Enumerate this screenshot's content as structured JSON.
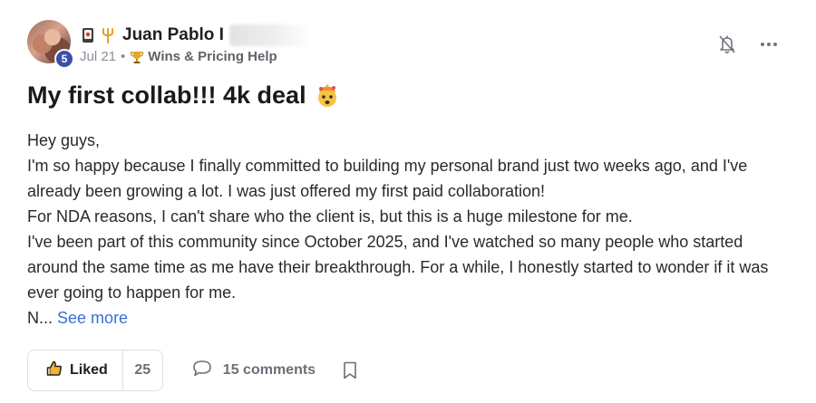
{
  "author": {
    "name": "Juan Pablo I",
    "level": "5",
    "icons": [
      "mobile-phone-icon",
      "trident-icon"
    ],
    "name_redacted": true
  },
  "meta": {
    "date": "Jul 21",
    "separator": "•",
    "category_icon": "trophy-icon",
    "category": "Wins & Pricing Help"
  },
  "header_actions": {
    "notify_icon": "bell-off-icon",
    "more_icon": "more-horizontal-icon"
  },
  "post": {
    "title": "My first collab!!! 4k deal",
    "title_emoji": "exploding-head-emoji",
    "body_lines": [
      "Hey guys,",
      "I'm so happy because I finally committed to building my personal brand just two weeks ago, and I've",
      "already been growing a lot. I was just offered my first paid collaboration!",
      "For NDA reasons, I can't share who the client is, but this is a huge milestone for me.",
      "I've been part of this community since October 2025, and I've watched so many people who started",
      "around the same time as me have their breakthrough. For a while, I honestly started to wonder if it was",
      "ever going to happen for me."
    ],
    "truncated_text": "N...",
    "see_more_label": "See more"
  },
  "footer": {
    "like_label": "Liked",
    "like_count": "25",
    "comments_label": "15 comments",
    "bookmark_icon": "bookmark-icon"
  },
  "colors": {
    "link": "#3b6fd6",
    "level_badge": "#3a4fa8",
    "muted_text": "#6b7078"
  }
}
